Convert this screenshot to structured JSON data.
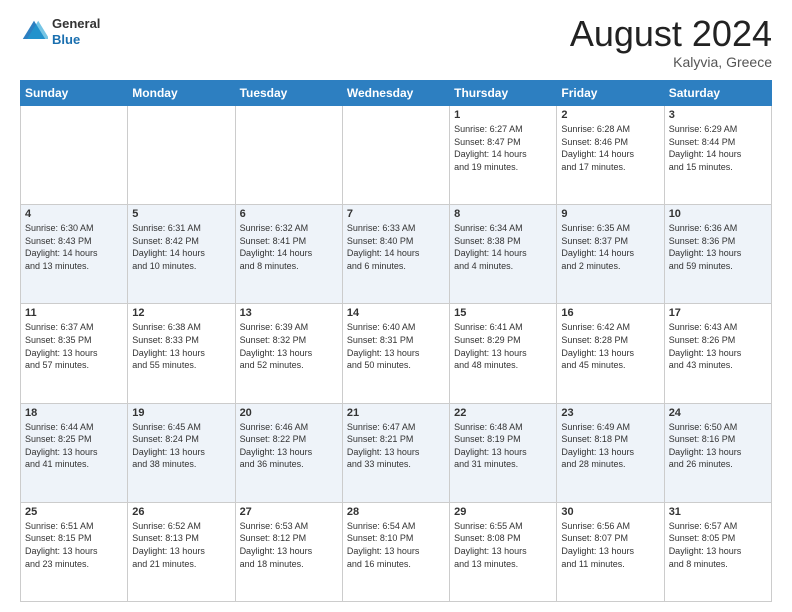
{
  "header": {
    "logo_general": "General",
    "logo_blue": "Blue",
    "month_title": "August 2024",
    "location": "Kalyvia, Greece"
  },
  "weekdays": [
    "Sunday",
    "Monday",
    "Tuesday",
    "Wednesday",
    "Thursday",
    "Friday",
    "Saturday"
  ],
  "weeks": [
    [
      {
        "day": "",
        "info": ""
      },
      {
        "day": "",
        "info": ""
      },
      {
        "day": "",
        "info": ""
      },
      {
        "day": "",
        "info": ""
      },
      {
        "day": "1",
        "info": "Sunrise: 6:27 AM\nSunset: 8:47 PM\nDaylight: 14 hours\nand 19 minutes."
      },
      {
        "day": "2",
        "info": "Sunrise: 6:28 AM\nSunset: 8:46 PM\nDaylight: 14 hours\nand 17 minutes."
      },
      {
        "day": "3",
        "info": "Sunrise: 6:29 AM\nSunset: 8:44 PM\nDaylight: 14 hours\nand 15 minutes."
      }
    ],
    [
      {
        "day": "4",
        "info": "Sunrise: 6:30 AM\nSunset: 8:43 PM\nDaylight: 14 hours\nand 13 minutes."
      },
      {
        "day": "5",
        "info": "Sunrise: 6:31 AM\nSunset: 8:42 PM\nDaylight: 14 hours\nand 10 minutes."
      },
      {
        "day": "6",
        "info": "Sunrise: 6:32 AM\nSunset: 8:41 PM\nDaylight: 14 hours\nand 8 minutes."
      },
      {
        "day": "7",
        "info": "Sunrise: 6:33 AM\nSunset: 8:40 PM\nDaylight: 14 hours\nand 6 minutes."
      },
      {
        "day": "8",
        "info": "Sunrise: 6:34 AM\nSunset: 8:38 PM\nDaylight: 14 hours\nand 4 minutes."
      },
      {
        "day": "9",
        "info": "Sunrise: 6:35 AM\nSunset: 8:37 PM\nDaylight: 14 hours\nand 2 minutes."
      },
      {
        "day": "10",
        "info": "Sunrise: 6:36 AM\nSunset: 8:36 PM\nDaylight: 13 hours\nand 59 minutes."
      }
    ],
    [
      {
        "day": "11",
        "info": "Sunrise: 6:37 AM\nSunset: 8:35 PM\nDaylight: 13 hours\nand 57 minutes."
      },
      {
        "day": "12",
        "info": "Sunrise: 6:38 AM\nSunset: 8:33 PM\nDaylight: 13 hours\nand 55 minutes."
      },
      {
        "day": "13",
        "info": "Sunrise: 6:39 AM\nSunset: 8:32 PM\nDaylight: 13 hours\nand 52 minutes."
      },
      {
        "day": "14",
        "info": "Sunrise: 6:40 AM\nSunset: 8:31 PM\nDaylight: 13 hours\nand 50 minutes."
      },
      {
        "day": "15",
        "info": "Sunrise: 6:41 AM\nSunset: 8:29 PM\nDaylight: 13 hours\nand 48 minutes."
      },
      {
        "day": "16",
        "info": "Sunrise: 6:42 AM\nSunset: 8:28 PM\nDaylight: 13 hours\nand 45 minutes."
      },
      {
        "day": "17",
        "info": "Sunrise: 6:43 AM\nSunset: 8:26 PM\nDaylight: 13 hours\nand 43 minutes."
      }
    ],
    [
      {
        "day": "18",
        "info": "Sunrise: 6:44 AM\nSunset: 8:25 PM\nDaylight: 13 hours\nand 41 minutes."
      },
      {
        "day": "19",
        "info": "Sunrise: 6:45 AM\nSunset: 8:24 PM\nDaylight: 13 hours\nand 38 minutes."
      },
      {
        "day": "20",
        "info": "Sunrise: 6:46 AM\nSunset: 8:22 PM\nDaylight: 13 hours\nand 36 minutes."
      },
      {
        "day": "21",
        "info": "Sunrise: 6:47 AM\nSunset: 8:21 PM\nDaylight: 13 hours\nand 33 minutes."
      },
      {
        "day": "22",
        "info": "Sunrise: 6:48 AM\nSunset: 8:19 PM\nDaylight: 13 hours\nand 31 minutes."
      },
      {
        "day": "23",
        "info": "Sunrise: 6:49 AM\nSunset: 8:18 PM\nDaylight: 13 hours\nand 28 minutes."
      },
      {
        "day": "24",
        "info": "Sunrise: 6:50 AM\nSunset: 8:16 PM\nDaylight: 13 hours\nand 26 minutes."
      }
    ],
    [
      {
        "day": "25",
        "info": "Sunrise: 6:51 AM\nSunset: 8:15 PM\nDaylight: 13 hours\nand 23 minutes."
      },
      {
        "day": "26",
        "info": "Sunrise: 6:52 AM\nSunset: 8:13 PM\nDaylight: 13 hours\nand 21 minutes."
      },
      {
        "day": "27",
        "info": "Sunrise: 6:53 AM\nSunset: 8:12 PM\nDaylight: 13 hours\nand 18 minutes."
      },
      {
        "day": "28",
        "info": "Sunrise: 6:54 AM\nSunset: 8:10 PM\nDaylight: 13 hours\nand 16 minutes."
      },
      {
        "day": "29",
        "info": "Sunrise: 6:55 AM\nSunset: 8:08 PM\nDaylight: 13 hours\nand 13 minutes."
      },
      {
        "day": "30",
        "info": "Sunrise: 6:56 AM\nSunset: 8:07 PM\nDaylight: 13 hours\nand 11 minutes."
      },
      {
        "day": "31",
        "info": "Sunrise: 6:57 AM\nSunset: 8:05 PM\nDaylight: 13 hours\nand 8 minutes."
      }
    ]
  ]
}
